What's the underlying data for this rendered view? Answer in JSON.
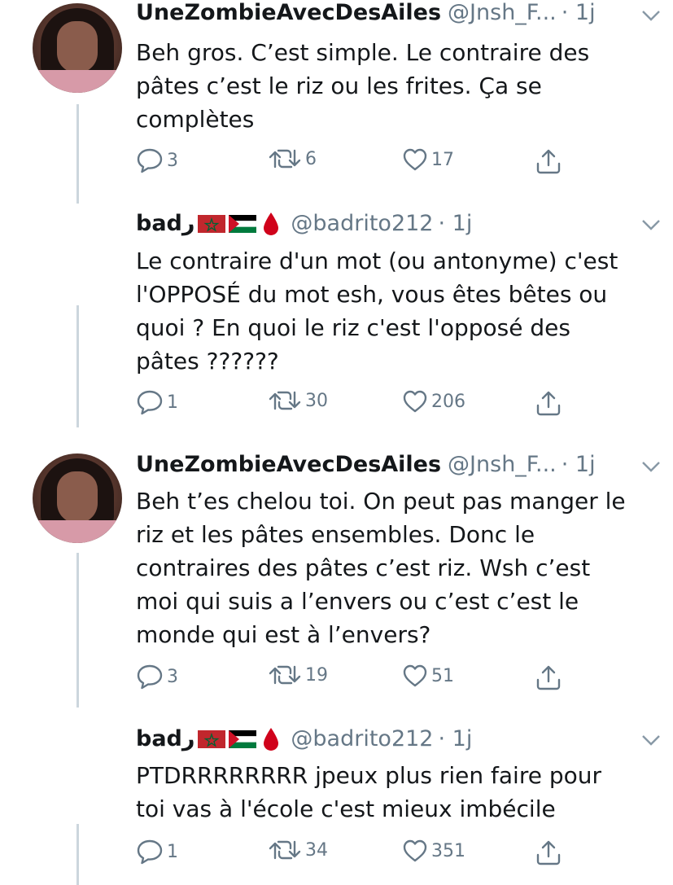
{
  "tweets": [
    {
      "name": "UneZombieAvecDesAiles",
      "handle": "@Jnsh_F...",
      "time": "· 1j",
      "text": "Beh gros. C’est simple. Le contraire des\npâtes c’est le riz ou les frites. Ça se\ncomplètes",
      "replies": "3",
      "retweets": "6",
      "likes": "17",
      "avatar_icon": "user-avatar"
    },
    {
      "name": "badر",
      "handle": "@badrito212",
      "time": "· 1j",
      "text": "Le contraire d'un mot (ou antonyme) c'est\nl'OPPOSÉ du mot esh, vous êtes bêtes ou\nquoi ? En quoi le riz c'est l'opposé des\npâtes ??????",
      "replies": "1",
      "retweets": "30",
      "likes": "206",
      "name_icons": [
        "morocco-flag-icon",
        "palestine-flag-icon",
        "blood-drop-icon"
      ]
    },
    {
      "name": "UneZombieAvecDesAiles",
      "handle": "@Jnsh_F...",
      "time": "· 1j",
      "text": "Beh t’es chelou toi. On peut pas manger le\nriz et les pâtes ensembles. Donc le\ncontraires des pâtes c’est riz. Wsh c’est\nmoi qui suis a l’envers ou c’est c’est le\nmonde qui est à l’envers?",
      "replies": "3",
      "retweets": "19",
      "likes": "51",
      "avatar_icon": "user-avatar"
    },
    {
      "name": "badر",
      "handle": "@badrito212",
      "time": "· 1j",
      "text": "PTDRRRRRRRR jpeux plus rien faire pour\ntoi vas à l'école c'est mieux imbécile",
      "replies": "1",
      "retweets": "34",
      "likes": "351",
      "name_icons": [
        "morocco-flag-icon",
        "palestine-flag-icon",
        "blood-drop-icon"
      ]
    }
  ],
  "colors": {
    "text": "#14171a",
    "secondary": "#657786",
    "thread_line": "#ccd6dd",
    "flag_red": "#c1272d",
    "flag_green": "#006233",
    "drop_red": "#d0021b"
  }
}
